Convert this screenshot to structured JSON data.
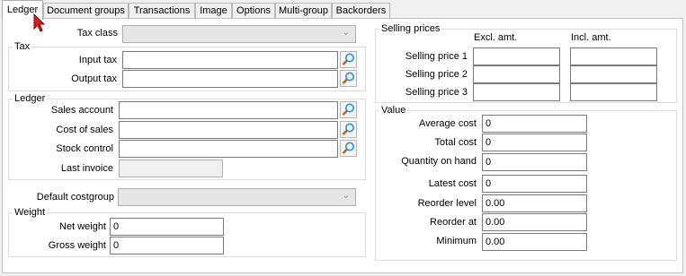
{
  "tabs": [
    {
      "label": "Ledger",
      "active": true
    },
    {
      "label": "Document groups"
    },
    {
      "label": "Transactions"
    },
    {
      "label": "Image"
    },
    {
      "label": "Options"
    },
    {
      "label": "Multi-group"
    },
    {
      "label": "Backorders"
    }
  ],
  "tax_class": {
    "label": "Tax class",
    "value": ""
  },
  "tax": {
    "title": "Tax",
    "input_tax_label": "Input tax",
    "output_tax_label": "Output tax",
    "input_tax": "",
    "output_tax": ""
  },
  "ledger": {
    "title": "Ledger",
    "sales_account_label": "Sales account",
    "cost_of_sales_label": "Cost of sales",
    "stock_control_label": "Stock control",
    "last_invoice_label": "Last invoice",
    "sales_account": "",
    "cost_of_sales": "",
    "stock_control": "",
    "last_invoice": ""
  },
  "default_costgroup": {
    "label": "Default costgroup",
    "value": ""
  },
  "weight": {
    "title": "Weight",
    "net_label": "Net weight",
    "gross_label": "Gross weight",
    "net": "0",
    "gross": "0"
  },
  "selling_prices": {
    "title": "Selling prices",
    "excl_header": "Excl. amt.",
    "incl_header": "Incl. amt.",
    "rows": [
      {
        "label": "Selling price 1",
        "excl": "",
        "incl": ""
      },
      {
        "label": "Selling price 2",
        "excl": "",
        "incl": ""
      },
      {
        "label": "Selling price 3",
        "excl": "",
        "incl": ""
      }
    ]
  },
  "value": {
    "title": "Value",
    "rows": [
      {
        "label": "Average cost",
        "value": "0"
      },
      {
        "label": "Total cost",
        "value": "0"
      },
      {
        "label": "Quantity on hand",
        "value": "0"
      },
      {
        "label": "Latest cost",
        "value": "0"
      },
      {
        "label": "Reorder level",
        "value": "0.00"
      },
      {
        "label": "Reorder at",
        "value": "0.00"
      },
      {
        "label": "Minimum",
        "value": "0.00"
      }
    ]
  },
  "colors": {
    "tab_active": "#ffffff",
    "panel_bg": "#ffffff",
    "window_bg": "#f0f0f0",
    "lookup_accent": "#2f8fd8"
  }
}
